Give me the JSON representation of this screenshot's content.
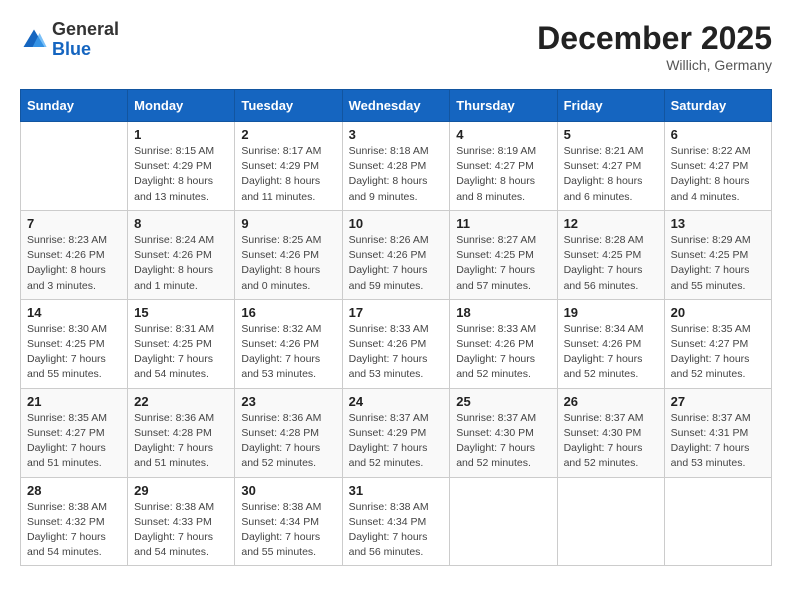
{
  "logo": {
    "general": "General",
    "blue": "Blue"
  },
  "title": {
    "month_year": "December 2025",
    "location": "Willich, Germany"
  },
  "headers": [
    "Sunday",
    "Monday",
    "Tuesday",
    "Wednesday",
    "Thursday",
    "Friday",
    "Saturday"
  ],
  "weeks": [
    [
      {
        "day": "",
        "info": ""
      },
      {
        "day": "1",
        "info": "Sunrise: 8:15 AM\nSunset: 4:29 PM\nDaylight: 8 hours\nand 13 minutes."
      },
      {
        "day": "2",
        "info": "Sunrise: 8:17 AM\nSunset: 4:29 PM\nDaylight: 8 hours\nand 11 minutes."
      },
      {
        "day": "3",
        "info": "Sunrise: 8:18 AM\nSunset: 4:28 PM\nDaylight: 8 hours\nand 9 minutes."
      },
      {
        "day": "4",
        "info": "Sunrise: 8:19 AM\nSunset: 4:27 PM\nDaylight: 8 hours\nand 8 minutes."
      },
      {
        "day": "5",
        "info": "Sunrise: 8:21 AM\nSunset: 4:27 PM\nDaylight: 8 hours\nand 6 minutes."
      },
      {
        "day": "6",
        "info": "Sunrise: 8:22 AM\nSunset: 4:27 PM\nDaylight: 8 hours\nand 4 minutes."
      }
    ],
    [
      {
        "day": "7",
        "info": "Sunrise: 8:23 AM\nSunset: 4:26 PM\nDaylight: 8 hours\nand 3 minutes."
      },
      {
        "day": "8",
        "info": "Sunrise: 8:24 AM\nSunset: 4:26 PM\nDaylight: 8 hours\nand 1 minute."
      },
      {
        "day": "9",
        "info": "Sunrise: 8:25 AM\nSunset: 4:26 PM\nDaylight: 8 hours\nand 0 minutes."
      },
      {
        "day": "10",
        "info": "Sunrise: 8:26 AM\nSunset: 4:26 PM\nDaylight: 7 hours\nand 59 minutes."
      },
      {
        "day": "11",
        "info": "Sunrise: 8:27 AM\nSunset: 4:25 PM\nDaylight: 7 hours\nand 57 minutes."
      },
      {
        "day": "12",
        "info": "Sunrise: 8:28 AM\nSunset: 4:25 PM\nDaylight: 7 hours\nand 56 minutes."
      },
      {
        "day": "13",
        "info": "Sunrise: 8:29 AM\nSunset: 4:25 PM\nDaylight: 7 hours\nand 55 minutes."
      }
    ],
    [
      {
        "day": "14",
        "info": "Sunrise: 8:30 AM\nSunset: 4:25 PM\nDaylight: 7 hours\nand 55 minutes."
      },
      {
        "day": "15",
        "info": "Sunrise: 8:31 AM\nSunset: 4:25 PM\nDaylight: 7 hours\nand 54 minutes."
      },
      {
        "day": "16",
        "info": "Sunrise: 8:32 AM\nSunset: 4:26 PM\nDaylight: 7 hours\nand 53 minutes."
      },
      {
        "day": "17",
        "info": "Sunrise: 8:33 AM\nSunset: 4:26 PM\nDaylight: 7 hours\nand 53 minutes."
      },
      {
        "day": "18",
        "info": "Sunrise: 8:33 AM\nSunset: 4:26 PM\nDaylight: 7 hours\nand 52 minutes."
      },
      {
        "day": "19",
        "info": "Sunrise: 8:34 AM\nSunset: 4:26 PM\nDaylight: 7 hours\nand 52 minutes."
      },
      {
        "day": "20",
        "info": "Sunrise: 8:35 AM\nSunset: 4:27 PM\nDaylight: 7 hours\nand 52 minutes."
      }
    ],
    [
      {
        "day": "21",
        "info": "Sunrise: 8:35 AM\nSunset: 4:27 PM\nDaylight: 7 hours\nand 51 minutes."
      },
      {
        "day": "22",
        "info": "Sunrise: 8:36 AM\nSunset: 4:28 PM\nDaylight: 7 hours\nand 51 minutes."
      },
      {
        "day": "23",
        "info": "Sunrise: 8:36 AM\nSunset: 4:28 PM\nDaylight: 7 hours\nand 52 minutes."
      },
      {
        "day": "24",
        "info": "Sunrise: 8:37 AM\nSunset: 4:29 PM\nDaylight: 7 hours\nand 52 minutes."
      },
      {
        "day": "25",
        "info": "Sunrise: 8:37 AM\nSunset: 4:30 PM\nDaylight: 7 hours\nand 52 minutes."
      },
      {
        "day": "26",
        "info": "Sunrise: 8:37 AM\nSunset: 4:30 PM\nDaylight: 7 hours\nand 52 minutes."
      },
      {
        "day": "27",
        "info": "Sunrise: 8:37 AM\nSunset: 4:31 PM\nDaylight: 7 hours\nand 53 minutes."
      }
    ],
    [
      {
        "day": "28",
        "info": "Sunrise: 8:38 AM\nSunset: 4:32 PM\nDaylight: 7 hours\nand 54 minutes."
      },
      {
        "day": "29",
        "info": "Sunrise: 8:38 AM\nSunset: 4:33 PM\nDaylight: 7 hours\nand 54 minutes."
      },
      {
        "day": "30",
        "info": "Sunrise: 8:38 AM\nSunset: 4:34 PM\nDaylight: 7 hours\nand 55 minutes."
      },
      {
        "day": "31",
        "info": "Sunrise: 8:38 AM\nSunset: 4:34 PM\nDaylight: 7 hours\nand 56 minutes."
      },
      {
        "day": "",
        "info": ""
      },
      {
        "day": "",
        "info": ""
      },
      {
        "day": "",
        "info": ""
      }
    ]
  ]
}
